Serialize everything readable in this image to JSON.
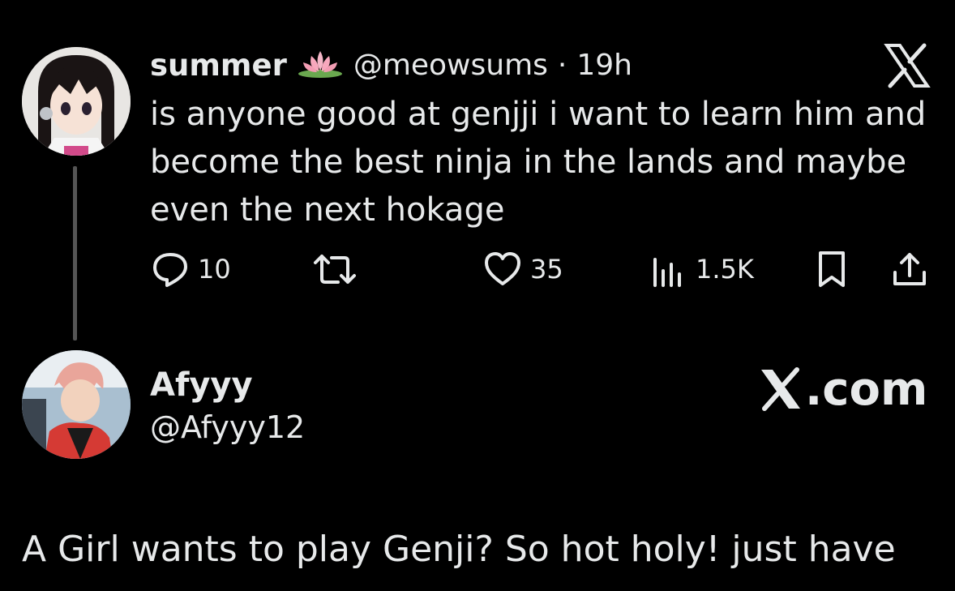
{
  "tweet": {
    "author_name": "summer",
    "author_emoji": "lotus-icon",
    "handle": "@meowsums",
    "separator": "·",
    "time": "19h",
    "text_lines": [
      "is anyone good at genjji i want to learn him and",
      "become the best ninja in the lands and maybe",
      "even the next hokage"
    ],
    "stats": {
      "replies": "10",
      "retweets": "",
      "likes": "35",
      "views": "1.5K"
    }
  },
  "reply": {
    "author_name": "Afyyy",
    "handle": "@Afyyy12",
    "site": ".com",
    "text_lines": [
      "A Girl wants to play Genji? So hot holy! just have"
    ]
  },
  "colors": {
    "background": "#000000",
    "text": "#e7e9ea",
    "thread_line": "#555555"
  }
}
